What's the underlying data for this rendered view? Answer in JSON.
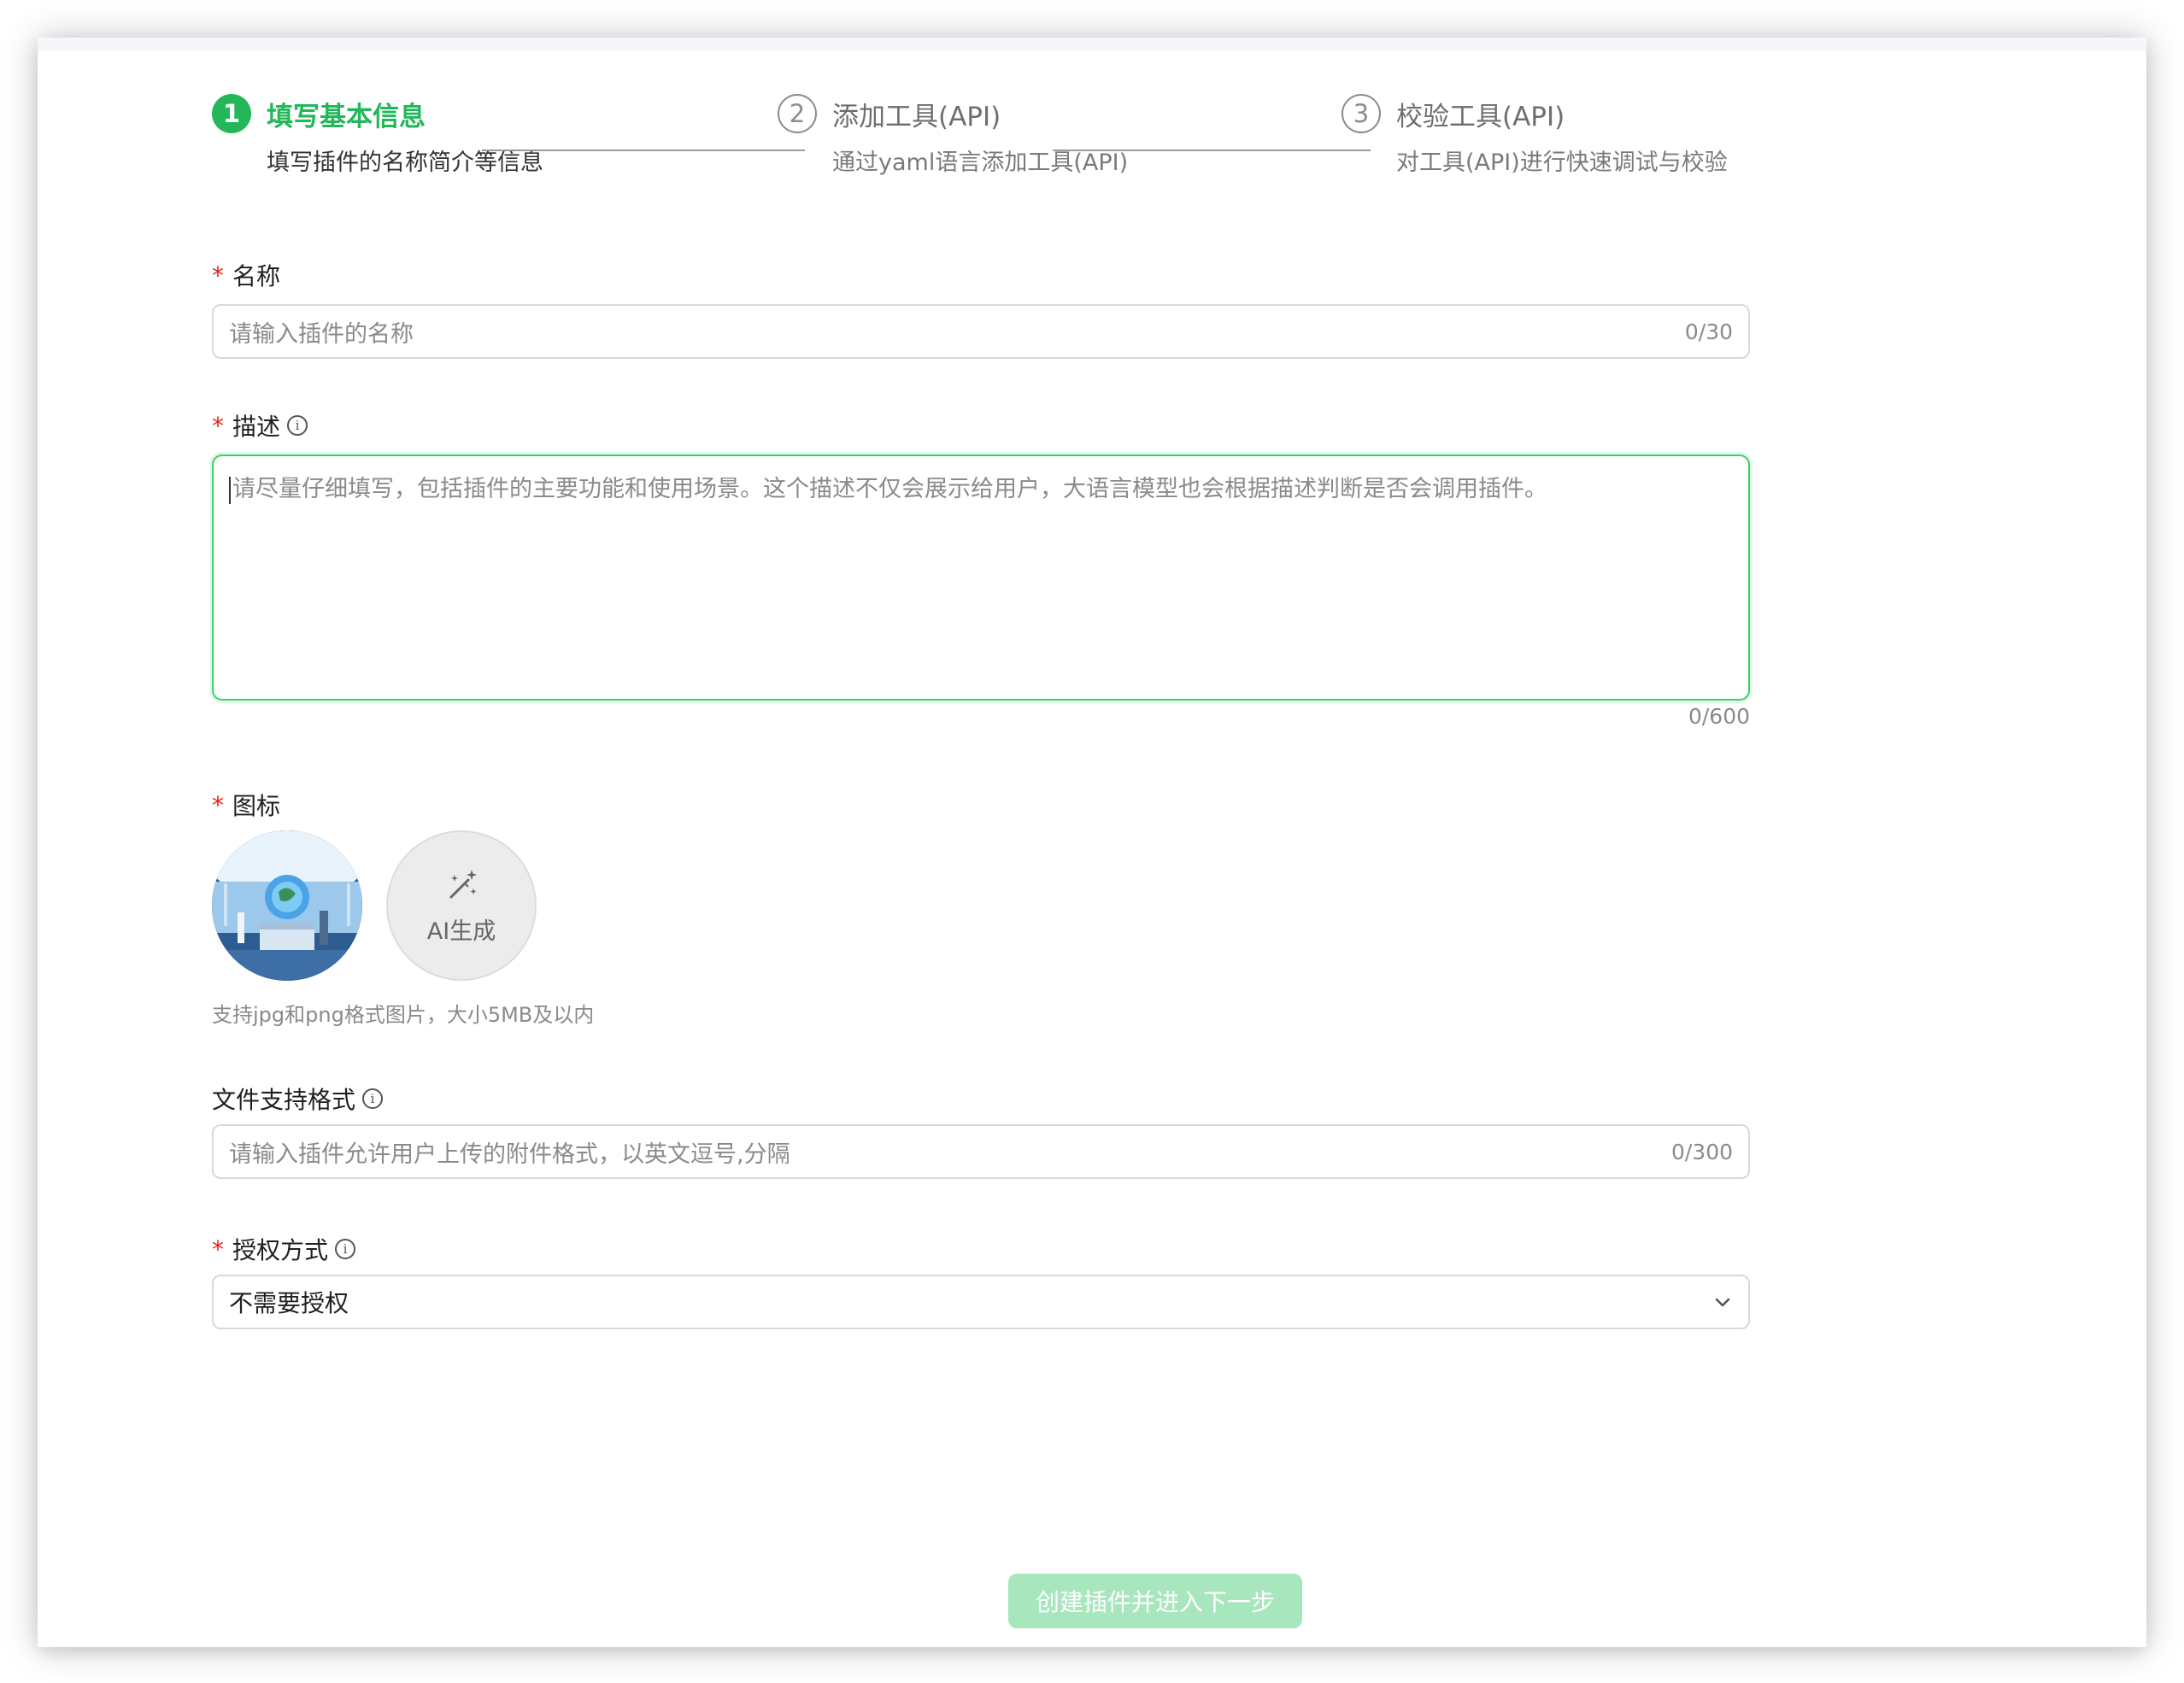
{
  "steps": [
    {
      "num": "1",
      "title": "填写基本信息",
      "desc": "填写插件的名称简介等信息"
    },
    {
      "num": "2",
      "title": "添加工具(API)",
      "desc": "通过yaml语言添加工具(API)"
    },
    {
      "num": "3",
      "title": "校验工具(API)",
      "desc": "对工具(API)进行快速调试与校验"
    }
  ],
  "form": {
    "name": {
      "label": "名称",
      "placeholder": "请输入插件的名称",
      "counter": "0/30"
    },
    "description": {
      "label": "描述",
      "placeholder": "请尽量仔细填写，包括插件的主要功能和使用场景。这个描述不仅会展示给用户，大语言模型也会根据描述判断是否会调用插件。",
      "counter": "0/600"
    },
    "icon": {
      "label": "图标",
      "ai_button": "AI生成",
      "hint": "支持jpg和png格式图片，大小5MB及以内"
    },
    "file_formats": {
      "label": "文件支持格式",
      "placeholder": "请输入插件允许用户上传的附件格式，以英文逗号,分隔",
      "counter": "0/300"
    },
    "auth": {
      "label": "授权方式",
      "value": "不需要授权"
    }
  },
  "submit_label": "创建插件并进入下一步",
  "colors": {
    "accent": "#22b85a",
    "required": "#e1251b",
    "submit_disabled": "#a8e6bd"
  }
}
